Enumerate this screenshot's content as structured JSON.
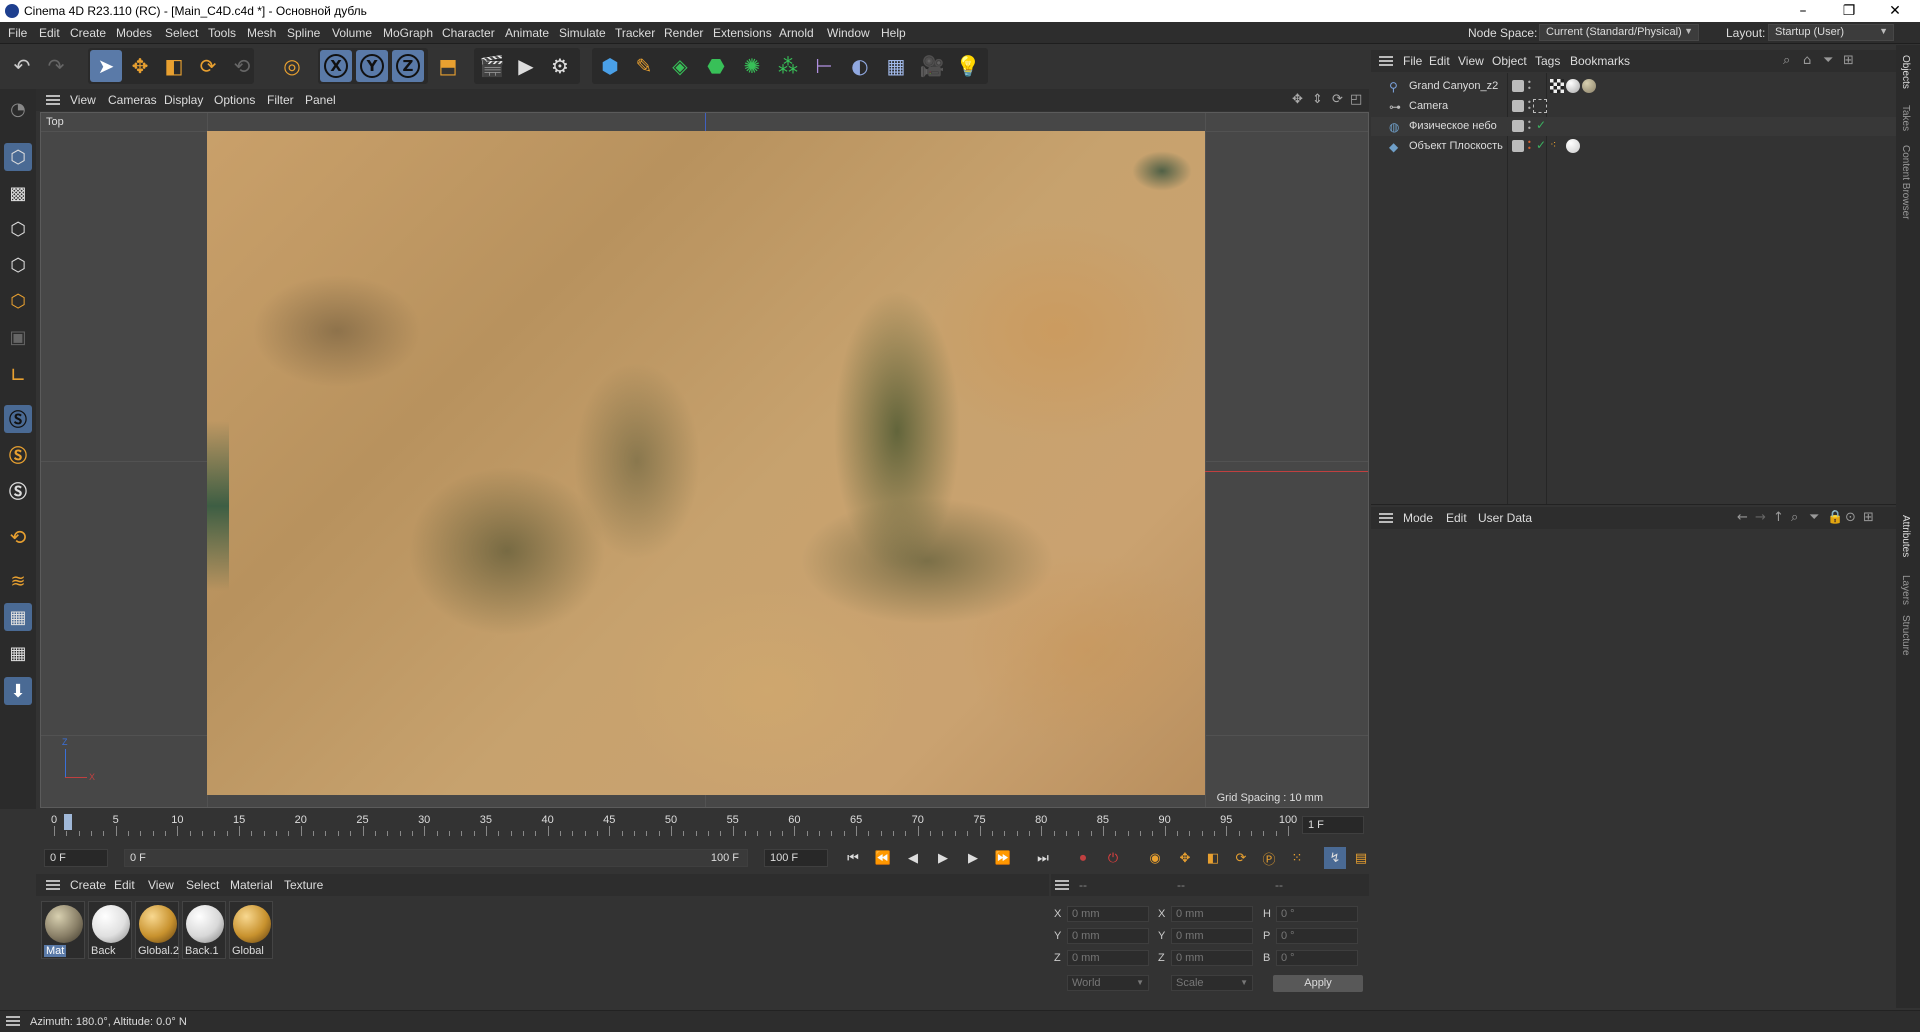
{
  "window": {
    "title": "Cinema 4D R23.110 (RC) - [Main_C4D.c4d *] - Основной дубль",
    "controls": [
      "–",
      "❐",
      "✕"
    ]
  },
  "menubar": {
    "items": [
      "File",
      "Edit",
      "Create",
      "Modes",
      "Select",
      "Tools",
      "Mesh",
      "Spline",
      "Volume",
      "MoGraph",
      "Character",
      "Animate",
      "Simulate",
      "Tracker",
      "Render",
      "Extensions",
      "Arnold",
      "Window",
      "Help"
    ],
    "node_space_label": "Node Space:",
    "node_space_value": "Current (Standard/Physical)",
    "layout_label": "Layout:",
    "layout_value": "Startup (User)"
  },
  "toolbar": {
    "axis_x": "X",
    "axis_y": "Y",
    "axis_z": "Z"
  },
  "viewport": {
    "menu": [
      "View",
      "Cameras",
      "Display",
      "Options",
      "Filter",
      "Panel"
    ],
    "view_name": "Top",
    "grid_spacing": "Grid Spacing : 10 mm",
    "axis_z": "Z",
    "axis_x": "X"
  },
  "timeline": {
    "ticks": [
      "0",
      "5",
      "10",
      "15",
      "20",
      "25",
      "30",
      "35",
      "40",
      "45",
      "50",
      "55",
      "60",
      "65",
      "70",
      "75",
      "80",
      "85",
      "90",
      "95",
      "100"
    ],
    "current_frame_field": "1 F",
    "start_field": "0 F",
    "range_start": "0 F",
    "range_end": "100 F",
    "end_field": "100 F"
  },
  "material_manager": {
    "menu": [
      "Create",
      "Edit",
      "View",
      "Select",
      "Material",
      "Texture"
    ],
    "materials": [
      {
        "name": "Mat",
        "color": "#8a8068",
        "selected": true
      },
      {
        "name": "Back",
        "color": "#e8e8e8",
        "selected": false
      },
      {
        "name": "Global.2",
        "color": "#c8922e",
        "selected": false
      },
      {
        "name": "Back.1",
        "color": "#d8d8d8",
        "selected": false
      },
      {
        "name": "Global",
        "color": "#c8922e",
        "selected": false
      }
    ]
  },
  "coordinates": {
    "head": [
      "--",
      "--",
      "--"
    ],
    "rows": [
      {
        "l1": "X",
        "v1": "0 mm",
        "l2": "X",
        "v2": "0 mm",
        "l3": "H",
        "v3": "0 °"
      },
      {
        "l1": "Y",
        "v1": "0 mm",
        "l2": "Y",
        "v2": "0 mm",
        "l3": "P",
        "v3": "0 °"
      },
      {
        "l1": "Z",
        "v1": "0 mm",
        "l2": "Z",
        "v2": "0 mm",
        "l3": "B",
        "v3": "0 °"
      }
    ],
    "mode1": "World",
    "mode2": "Scale",
    "apply": "Apply"
  },
  "object_manager": {
    "menu": [
      "File",
      "Edit",
      "View",
      "Object",
      "Tags",
      "Bookmarks"
    ],
    "objects": [
      {
        "name": "Grand Canyon_z2",
        "icon_color": "#7aa0d8"
      },
      {
        "name": "Camera",
        "icon_color": "#bbbbbb"
      },
      {
        "name": "Физическое небо",
        "icon_color": "#6f9fc8"
      },
      {
        "name": "Объект Плоскость",
        "icon_color": "#6f9fc8"
      }
    ]
  },
  "attributes": {
    "menu": [
      "Mode",
      "Edit",
      "User Data"
    ]
  },
  "right_tabs": [
    "Objects",
    "Takes",
    "Content Browser",
    "Attributes",
    "Layers",
    "Structure"
  ],
  "statusbar": {
    "text": "Azimuth: 180.0°, Altitude: 0.0°  N"
  }
}
